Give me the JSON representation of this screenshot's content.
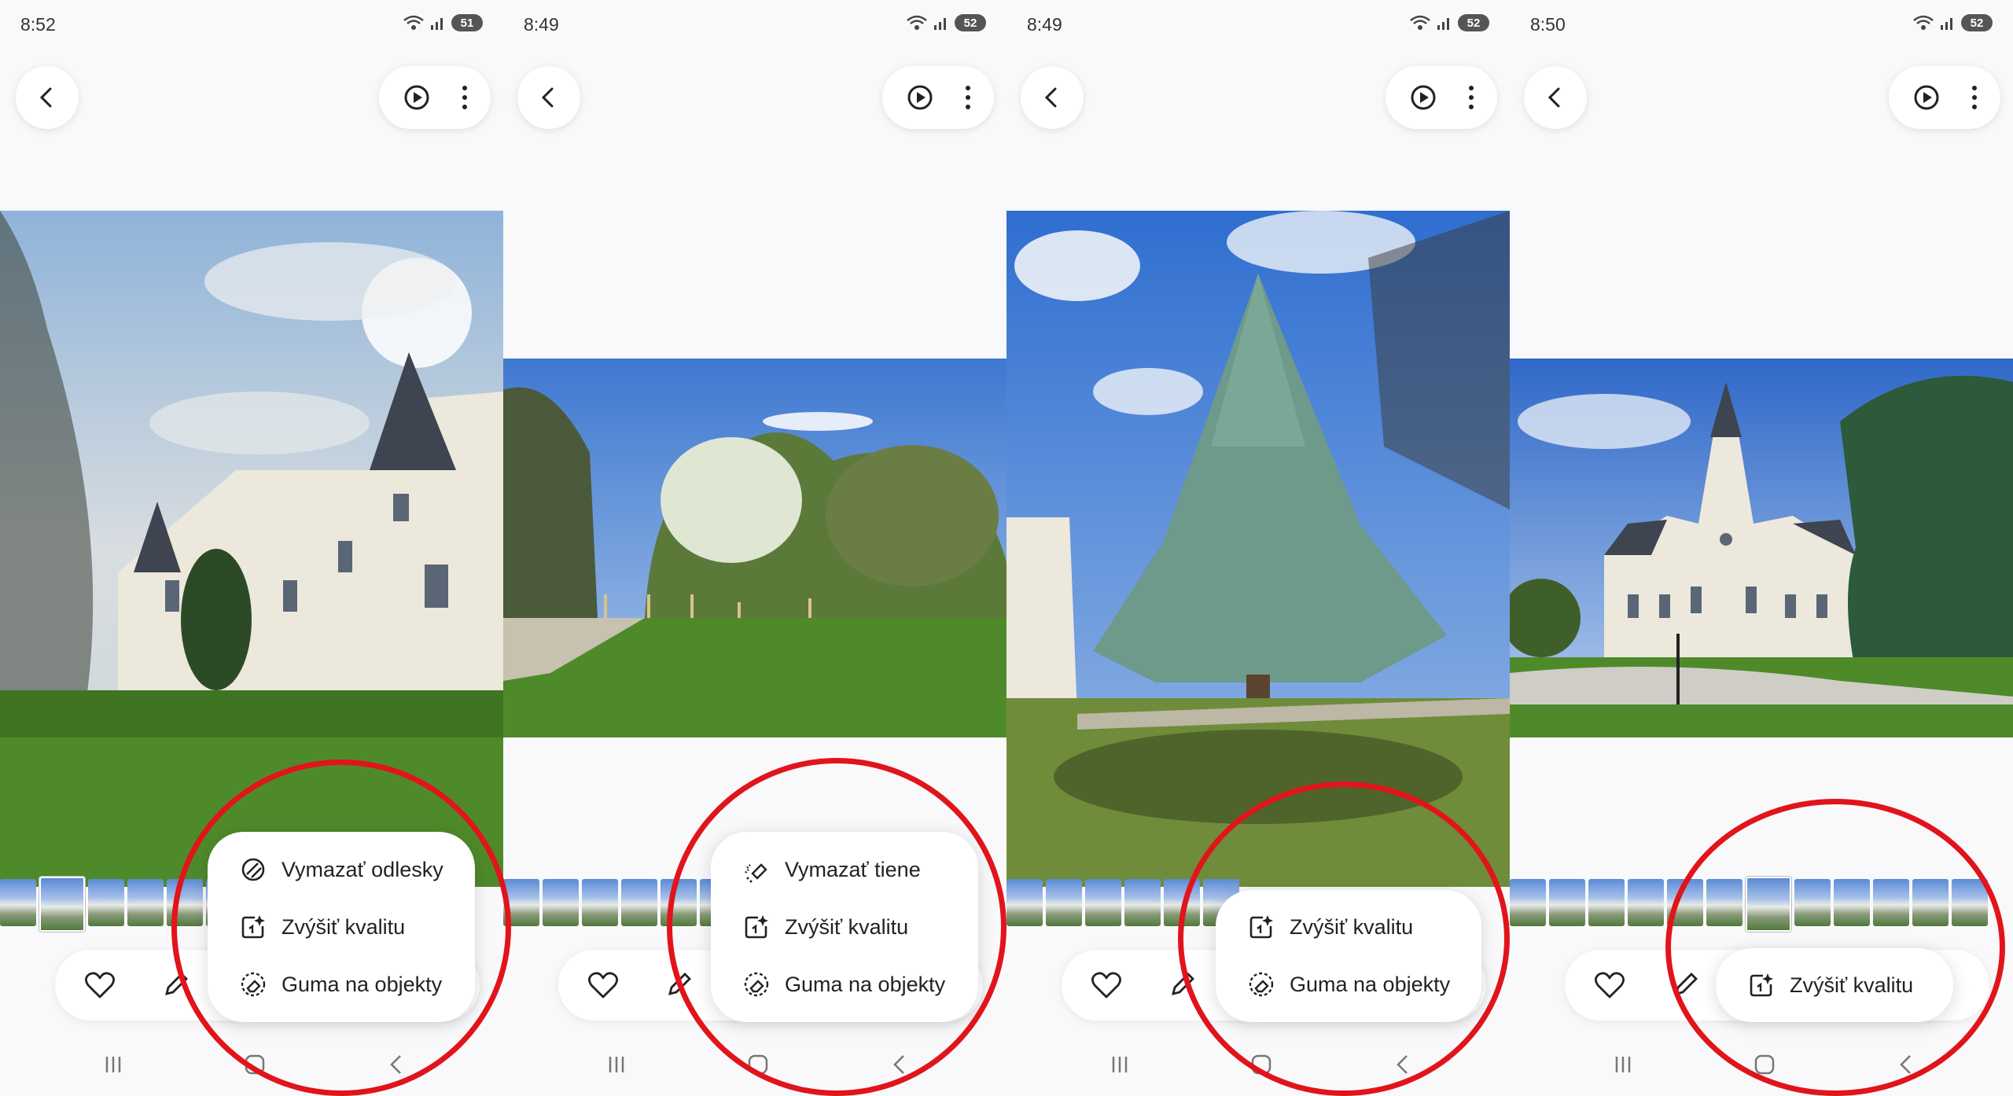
{
  "panels": [
    {
      "status": {
        "time": "8:52",
        "battery": "51"
      },
      "menu": [
        {
          "icon": "erase-reflection-icon",
          "label": "Vymazať odlesky"
        },
        {
          "icon": "enhance-quality-icon",
          "label": "Zvýšiť kvalitu"
        },
        {
          "icon": "object-eraser-icon",
          "label": "Guma na objekty"
        }
      ]
    },
    {
      "status": {
        "time": "8:49",
        "battery": "52"
      },
      "menu": [
        {
          "icon": "erase-shadow-icon",
          "label": "Vymazať tiene"
        },
        {
          "icon": "enhance-quality-icon",
          "label": "Zvýšiť kvalitu"
        },
        {
          "icon": "object-eraser-icon",
          "label": "Guma na objekty"
        }
      ]
    },
    {
      "status": {
        "time": "8:49",
        "battery": "52"
      },
      "menu": [
        {
          "icon": "enhance-quality-icon",
          "label": "Zvýšiť kvalitu"
        },
        {
          "icon": "object-eraser-icon",
          "label": "Guma na objekty"
        }
      ]
    },
    {
      "status": {
        "time": "8:50",
        "battery": "52"
      },
      "menu": [
        {
          "icon": "enhance-quality-icon",
          "label": "Zvýšiť kvalitu"
        }
      ]
    }
  ],
  "colors": {
    "highlight_circle": "#e1141b",
    "sky": "#4f86d6",
    "grass": "#4f8a2a"
  }
}
